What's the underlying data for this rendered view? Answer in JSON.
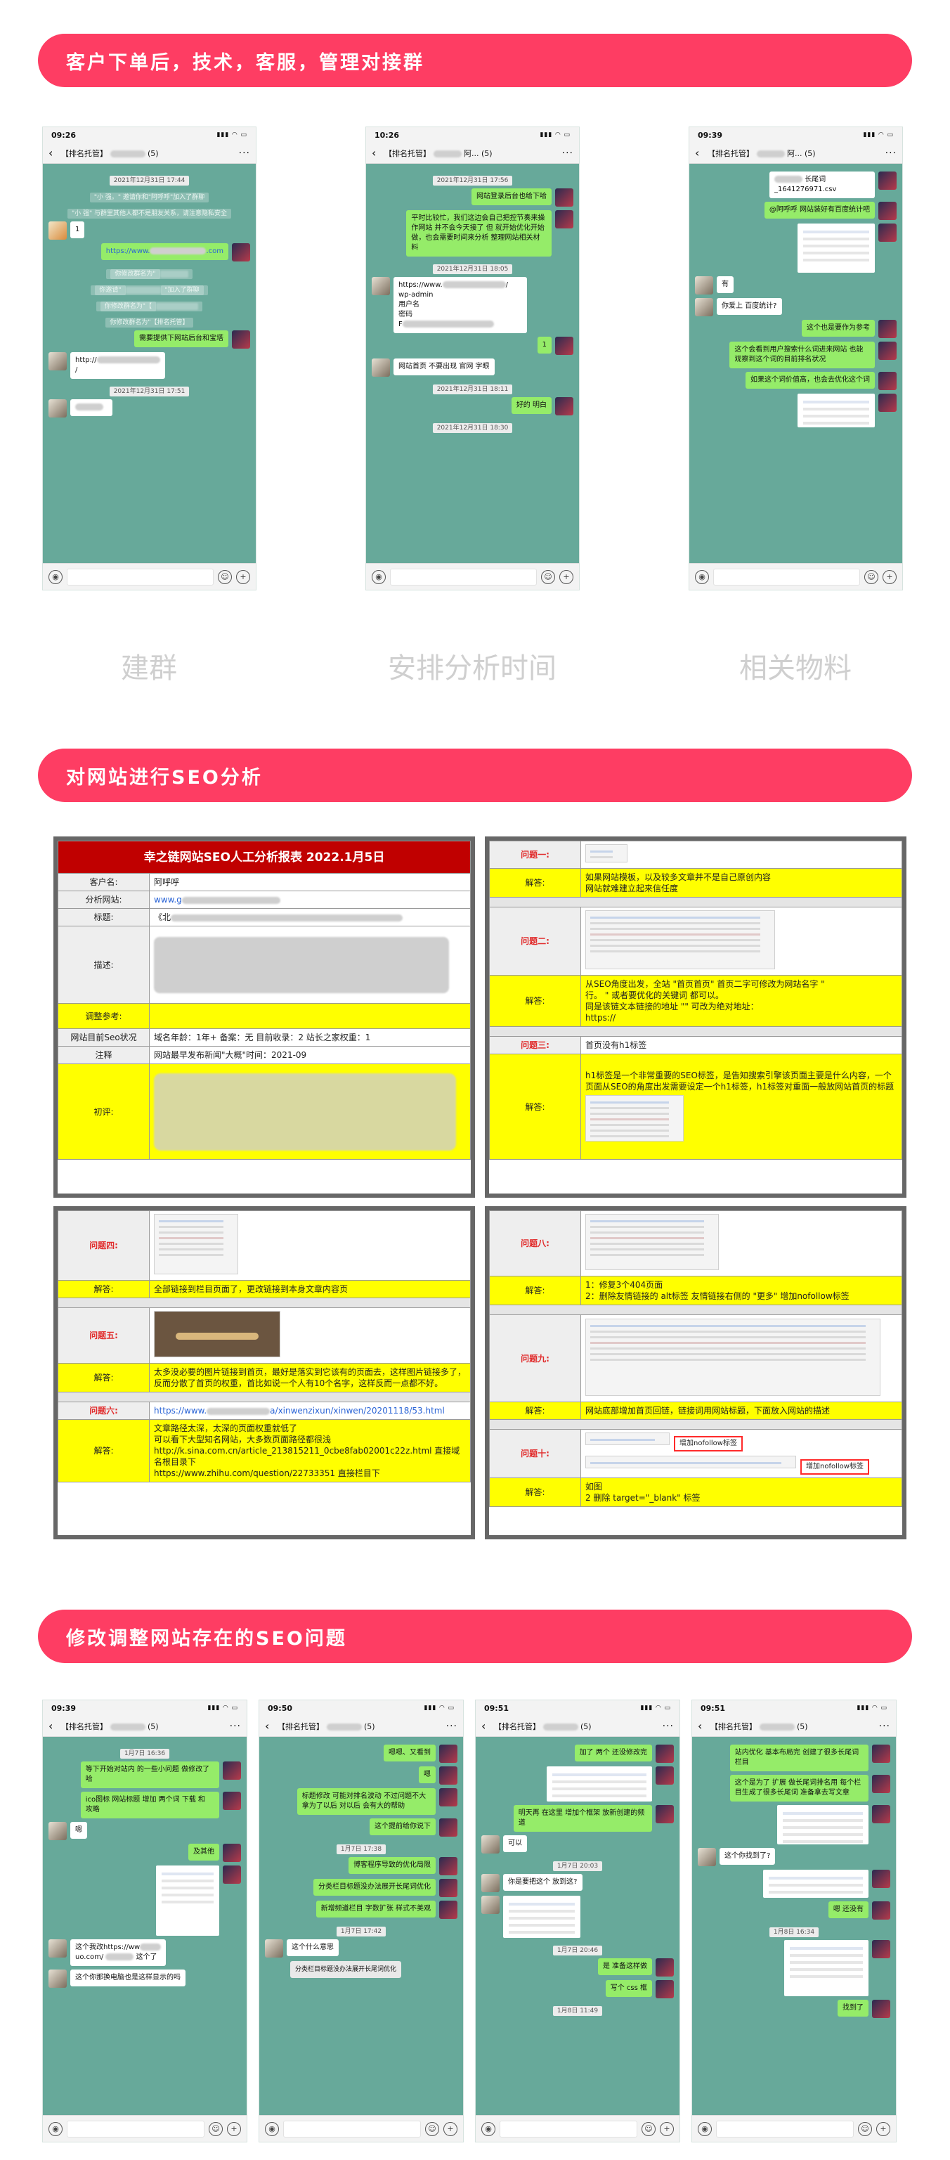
{
  "sections": [
    {
      "title": "客户下单后，技术，客服，管理对接群"
    },
    {
      "title": "对网站进行SEO分析"
    },
    {
      "title": "修改调整网站存在的SEO问题"
    }
  ],
  "captions": [
    "建群",
    "安排分析时间",
    "相关物料"
  ],
  "phones": {
    "p1": {
      "time": "09:26",
      "title": "【排名托管】",
      "count": "(5)",
      "msgs": {
        "ts1": "2021年12月31日 17:44",
        "sys1": "\"小 强。\" 邀请你和\"阿呼呼\"加入了群聊",
        "sys2": "\"小 强\" 与群里其他人都不是朋友关系，请注意隐私安全",
        "m1": "1",
        "m2": "https://www.",
        "m2b": ".com",
        "sys3": "你修改群名为\"",
        "sys4": "你邀请\"",
        "sys4b": "\"加入了群聊",
        "sys5": "你修改群名为\"【",
        "sys6": "你修改群名为\"【排名托管】",
        "m3": "需要提供下网站后台和宝塔",
        "m4": "http://",
        "ts2": "2021年12月31日 17:51"
      }
    },
    "p2": {
      "time": "10:26",
      "title": "【排名托管】",
      "title2": "阿...",
      "count": "(5)",
      "msgs": {
        "ts1": "2021年12月31日 17:56",
        "m1": "网站登录后台也给下哈",
        "m2": "平时比较忙，我们这边会自己把控节奏来操作网站 并不会今天接了 但 就开始优化开始做，也会需要时间来分析 整理网站相关材料",
        "ts2": "2021年12月31日 18:05",
        "m3a": "https://www.",
        "m3b": "wp-admin",
        "m3c": "用户名",
        "m3d": "密码",
        "m4": "1",
        "m5": "网站首页 不要出现 官网 字眼",
        "ts3": "2021年12月31日 18:11",
        "m6": "好的 明白",
        "ts4": "2021年12月31日 18:30"
      }
    },
    "p3": {
      "time": "09:39",
      "title": "【排名托管】",
      "title2": "阿...",
      "count": "(5)",
      "msgs": {
        "file": "长尾词_1641276971.csv",
        "m1": "@阿呼呼 网站装好有百度统计吧",
        "m2": "有",
        "m3": "你爱上 百度统计?",
        "m4": "这个也是要作为参考",
        "m5": "这个会看到用户搜索什么词进来网站 也能观察到这个词的目前排名状况",
        "m6": "如果这个词价值高，也会去优化这个词"
      }
    },
    "p4": {
      "time": "09:39",
      "title": "【排名托管】",
      "count": "(5)",
      "msgs": {
        "ts1": "1月7日 16:36",
        "m1": "等下开始对站内 的一些小问题 做修改了哈",
        "m2": "ico图标 网站标题 增加 两个词 下载 和 攻略",
        "m3": "嗯",
        "m4": "及其他",
        "m5": "这个我改https://ww",
        "m5b": "uo.com/",
        "m5c": "这个了",
        "m6": "这个你那换电脑也是这样显示的吗"
      }
    },
    "p5": {
      "time": "09:50",
      "title": "【排名托管】",
      "count": "(5)",
      "msgs": {
        "m1": "嗯嗯、又看到",
        "m2": "嗯",
        "m3": "标题修改 可能对排名波动 不过问题不大 拿为了以后 对以后 会有大的帮助",
        "m4": "这个提前给你说下",
        "ts1": "1月7日 17:38",
        "m5": "博客程序导致的优化局限",
        "m6": "分类栏目标题没办法展开长尾词优化",
        "m7": "新增频道栏目 字数扩张 样式不美观",
        "ts2": "1月7日 17:42",
        "m8": "这个什么意思",
        "m9": "分类栏目标题没办法展开长尾词优化"
      }
    },
    "p6": {
      "time": "09:51",
      "title": "【排名托管】",
      "count": "(5)",
      "msgs": {
        "m1": "加了 两个 还没修改完",
        "m2": "明天再 在这里 增加个框架 放新创建的频道",
        "m3": "可以",
        "ts1": "1月7日 20:03",
        "m4": "你是要把这个 放到这?",
        "ts2": "1月7日 20:46",
        "m5": "是 准备这样做",
        "m6": "写个 css 框",
        "ts3": "1月8日 11:49"
      }
    },
    "p7": {
      "time": "09:51",
      "title": "【排名托管】",
      "count": "(5)",
      "msgs": {
        "m1": "站内优化 基本布局完 创建了很多长尾词栏目",
        "m2": "这个是为了 扩展 做长尾词排名用 每个栏目生成了很多长尾词 准备拿去写文章",
        "m3": "这个你找到了?",
        "m4": "嗯 还没有",
        "ts1": "1月8日 16:34",
        "m5": "找到了"
      }
    }
  },
  "report": {
    "title": "幸之链网站SEO人工分析报表 2022.1月5日",
    "rows": {
      "customer_label": "客户名:",
      "customer": "阿呼呼",
      "site_label": "分析网站:",
      "site": "www.g",
      "title_label": "标题:",
      "title_val": "《北",
      "desc_label": "描述:",
      "ref_label": "调整参考:",
      "status_label": "网站目前Seo状况",
      "status": "域名年龄：1年+    备案：无    目前收录：2              站长之家权重：1",
      "note_label": "注释",
      "note": "网站最早发布新闻\"大概\"时间：2021-09",
      "eval_label": "初评:"
    }
  },
  "issues": {
    "q1": {
      "label": "问题一:",
      "answer": "如果网站模板，以及较多文章并不是自己原创内容\n网站就难建立起来信任度"
    },
    "q2": {
      "label": "问题二:",
      "answer": "从SEO角度出发，全站 \"首页首页\"   首页二字可修改为网站名字 \"\n行。                              \"  或者要优化的关键词  都可以。\n同是该链文本链接的地址 \"\" 可改为绝对地址：\nhttps://"
    },
    "q3": {
      "label": "问题三:",
      "problem": "首页没有h1标签",
      "answer": "h1标签是一个非常重要的SEO标签，是告知搜索引擎该页面主要是什么内容，一个页面从SEO的角度出发需要设定一个h1标签，h1标签对重面一般放网站首页的标题"
    },
    "q4": {
      "label": "问题四:",
      "answer": "全部链接到栏目页面了，更改链接到本身文章内容页"
    },
    "q5": {
      "label": "问题五:",
      "answer": "太多没必要的图片链接到首页，最好是落实到它该有的页面去，这样图片链接多了，反而分散了首页的权重，首比如说一个人有10个名字，这样反而一点都不好。"
    },
    "q6": {
      "label": "问题六:",
      "problem_a": "https://www.",
      "problem_b": "a/xinwenzixun/xinwen/20201118/53.html",
      "answer": "文章路径太深，太深的页面权重就低了\n可以看下大型知名网站，大多数页面路径都很浅\nhttp://k.sina.com.cn/article_213815211_0cbe8fab02001c22z.html  直接域名根目录下\nhttps://www.zhihu.com/question/22733351  直接栏目下"
    },
    "q8": {
      "label": "问题八:",
      "answer": "1：修复3个404页面\n2：删除友情链接的 alt标签  友情链接右侧的 \"更多\" 增加nofollow标签"
    },
    "q9": {
      "label": "问题九:",
      "answer": "网站底部增加首页回链，链接词用网站标题，下面放入网站的描述"
    },
    "q10": {
      "label": "问题十:",
      "tag1": "增加nofollow标签",
      "tag2": "增加nofollow标签",
      "answer": "如图\n2 删除   target=\"_blank\" 标签"
    }
  },
  "colors": {
    "banner": "#fe3d63",
    "chat_bg": "#67a99a",
    "bubble_green": "#95ec69",
    "report_red": "#c00000",
    "answer_yellow": "#ffff00"
  }
}
